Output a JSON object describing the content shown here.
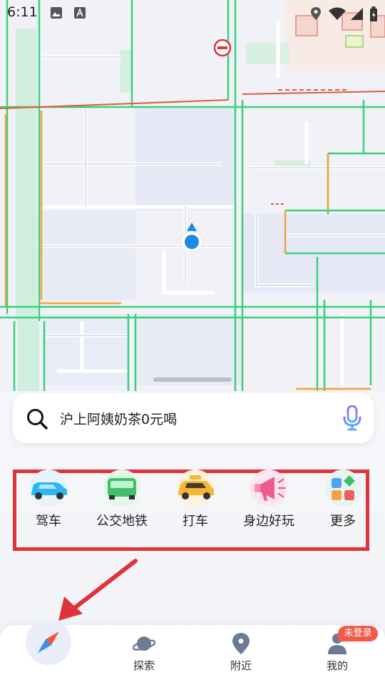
{
  "status_bar": {
    "time": "6:11",
    "icons": [
      "image-icon",
      "text-a-icon",
      "location-icon",
      "wifi-icon",
      "signal-icon",
      "battery-icon"
    ]
  },
  "map": {
    "colors": {
      "background": "#f1f2f8",
      "road_major": "#38d07a",
      "road_orange": "#f2a23b",
      "road_red": "#e25a3c",
      "park": "#cfeedd",
      "location_dot": "#1e88e5"
    },
    "icons": [
      "no-entry-icon",
      "my-location-icon"
    ]
  },
  "search": {
    "text": "沪上阿姨奶茶0元喝",
    "icons": [
      "search-icon",
      "microphone-icon"
    ]
  },
  "quick_actions": [
    {
      "label": "驾车",
      "icon": "car-icon"
    },
    {
      "label": "公交地铁",
      "icon": "bus-icon"
    },
    {
      "label": "打车",
      "icon": "taxi-icon"
    },
    {
      "label": "身边好玩",
      "icon": "megaphone-icon"
    },
    {
      "label": "更多",
      "icon": "grid-more-icon"
    }
  ],
  "annotation": {
    "highlight_color": "#e0323a"
  },
  "bottom_nav": {
    "items": [
      {
        "label": "",
        "icon": "compass-icon"
      },
      {
        "label": "探索",
        "icon": "planet-icon"
      },
      {
        "label": "附近",
        "icon": "map-pin-icon"
      },
      {
        "label": "我的",
        "icon": "user-icon"
      }
    ],
    "badge": "未登录"
  }
}
